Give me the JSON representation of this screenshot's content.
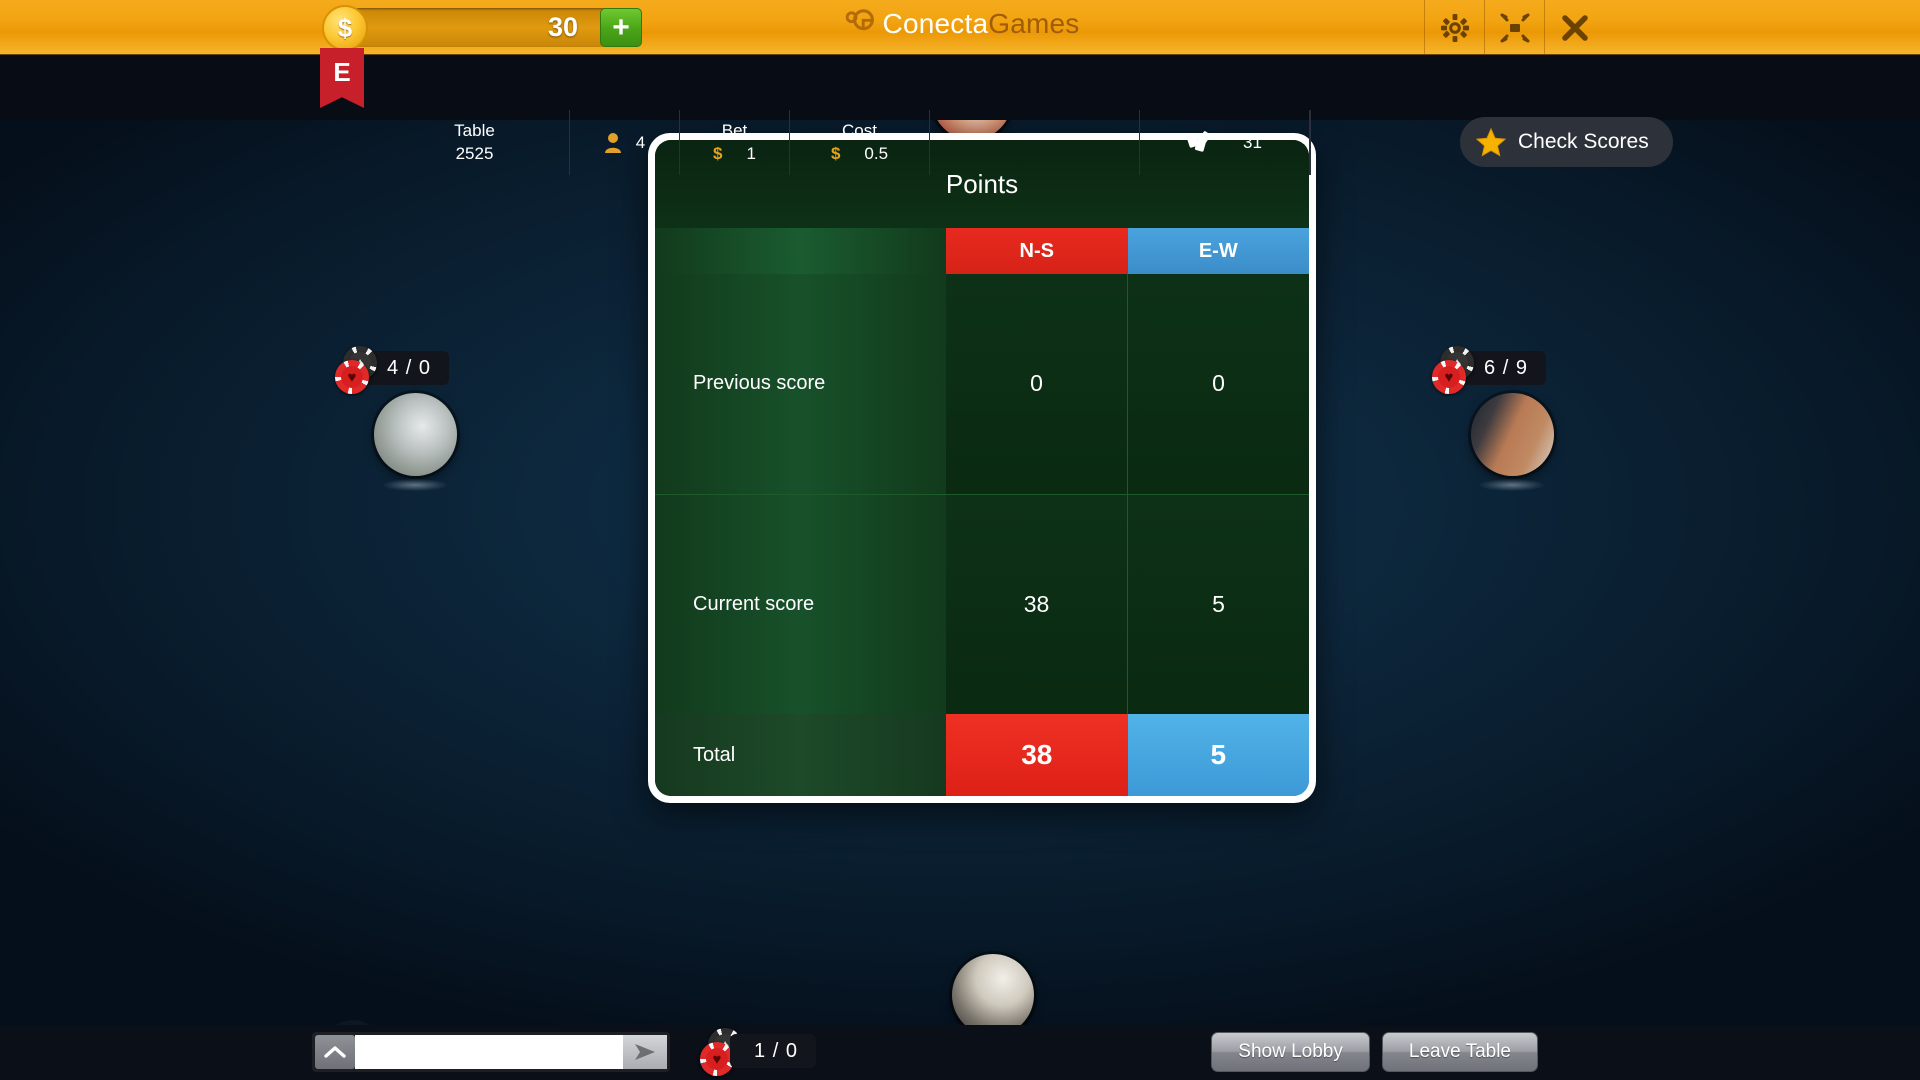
{
  "topbar": {
    "coin_icon": "dollar-coin-icon",
    "coin_amount": "30",
    "add_coins_label": "+",
    "brand_first": "Conecta",
    "brand_second": "Games",
    "settings_icon": "gear-icon",
    "fullscreen_icon": "fullscreen-icon",
    "close_icon": "close-icon"
  },
  "infobar": {
    "seat_flag": "E",
    "table_label": "Table",
    "table_value": "2525",
    "players_icon": "person-icon",
    "players_value": "4",
    "bet_label": "Bet",
    "bet_currency": "$",
    "bet_value": "1",
    "cost_label": "Cost",
    "cost_currency": "$",
    "cost_value": "0.5",
    "cards_icon": "cards-icon",
    "cards_value": "31",
    "check_scores_icon": "star-icon",
    "check_scores_label": "Check Scores"
  },
  "dialog": {
    "title": "Points",
    "columns": [
      "",
      "N-S",
      "E-W"
    ],
    "rows": [
      {
        "label": "Previous score",
        "ns": "0",
        "ew": "0"
      },
      {
        "label": "Current score",
        "ns": "38",
        "ew": "5"
      },
      {
        "label": "Total",
        "ns": "38",
        "ew": "5"
      }
    ],
    "colors": {
      "ns": "#e8291e",
      "ew": "#4aa3dd",
      "felt": "#0d3116"
    }
  },
  "players": {
    "west": {
      "tricks": "4 / 0",
      "chip_black": "♠",
      "chip_red": "♥"
    },
    "east": {
      "tricks": "6 / 9",
      "chip_black": "♠",
      "chip_red": "♥"
    },
    "south": {
      "tricks": "1 / 0",
      "chip_black": "♠",
      "chip_red": "♥"
    }
  },
  "bottombar": {
    "coffee_icon": "coffee-cup-icon",
    "chat_toggle_icon": "chevron-up-icon",
    "chat_value": "",
    "chat_placeholder": "",
    "chat_send_icon": "send-icon",
    "show_lobby_label": "Show Lobby",
    "leave_table_label": "Leave Table"
  }
}
